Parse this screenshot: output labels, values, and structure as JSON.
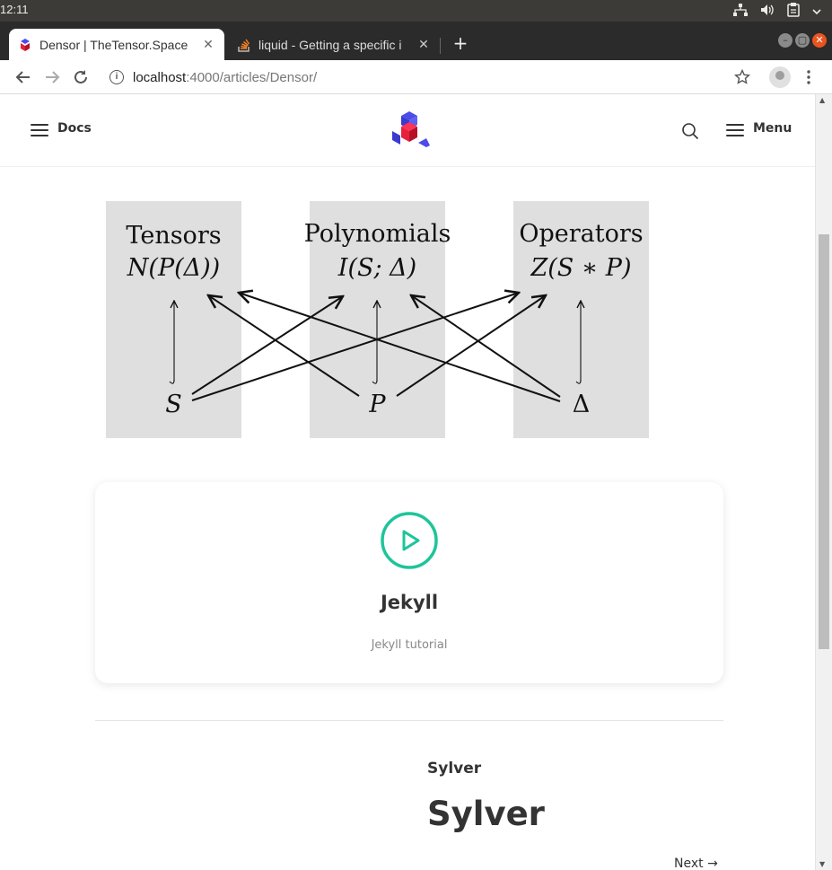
{
  "os": {
    "time": "12:11",
    "tray_icons": [
      "network-icon",
      "volume-icon",
      "clipboard-icon",
      "chevron-down-icon"
    ]
  },
  "browser": {
    "tabs": [
      {
        "title": "Densor | TheTensor.Space",
        "close": "✕",
        "active": true
      },
      {
        "title": "liquid - Getting a specific i",
        "close": "✕",
        "active": false
      }
    ],
    "new_tab": "+",
    "url_host": "localhost",
    "url_path": ":4000/articles/Densor/"
  },
  "header": {
    "docs_label": "Docs",
    "menu_label": "Menu"
  },
  "diagram": {
    "columns": [
      {
        "title": "Tensors",
        "formula": "N(P(Δ))",
        "base": "S"
      },
      {
        "title": "Polynomials",
        "formula": "I(S; Δ)",
        "base": "P"
      },
      {
        "title": "Operators",
        "formula": "Z(S ∗ P)",
        "base": "Δ"
      }
    ]
  },
  "card": {
    "title": "Jekyll",
    "subtitle": "Jekyll tutorial",
    "accent": "#1fc49a"
  },
  "next": {
    "kicker": "Sylver",
    "title": "Sylver",
    "link": "Next →"
  }
}
